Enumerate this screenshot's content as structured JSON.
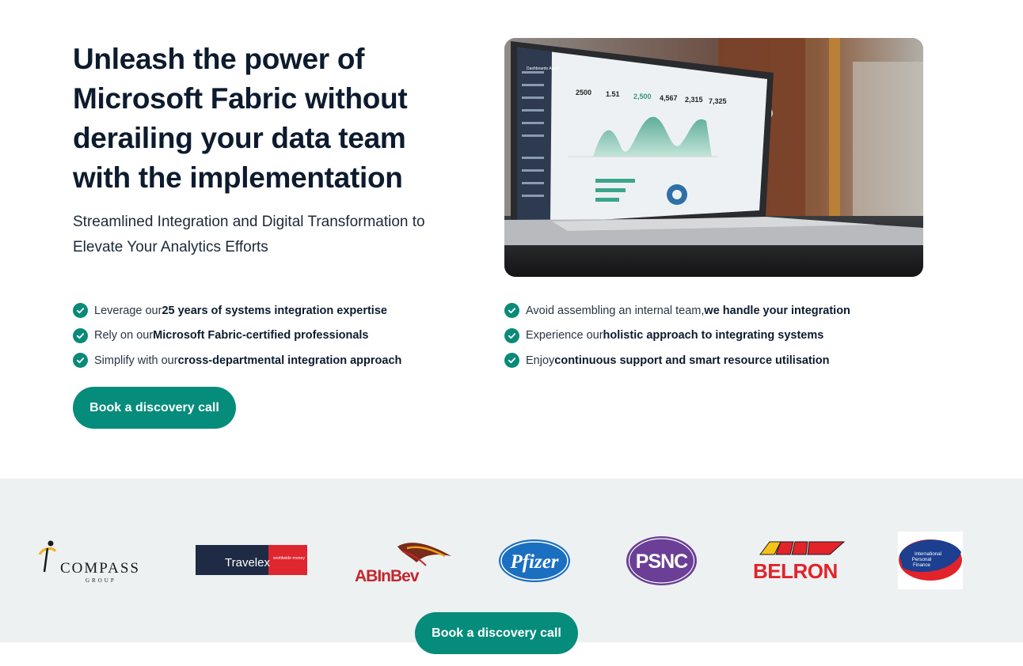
{
  "hero": {
    "headline": "Unleash the power of Microsoft Fabric without derailing your data team with the implementation",
    "subheadline": "Streamlined Integration and Digital Transformation to Elevate Your Analytics Efforts",
    "image_alt": "Laptop displaying an analytics dashboard",
    "dashboard": {
      "title": "Dashboardo Agent",
      "stats": [
        "2500",
        "1.51",
        "2,500",
        "4,567",
        "2,315",
        "7,325"
      ]
    }
  },
  "benefits_left": [
    {
      "pre": "Leverage our ",
      "bold": "25 years of systems integration expertise",
      "post": ""
    },
    {
      "pre": "Rely on our ",
      "bold": "Microsoft Fabric-certified professionals",
      "post": ""
    },
    {
      "pre": "Simplify with our ",
      "bold": "cross-departmental integration approach",
      "post": ""
    }
  ],
  "benefits_right": [
    {
      "pre": "Avoid assembling an internal team, ",
      "bold": "we handle your integration",
      "post": ""
    },
    {
      "pre": "Experience our ",
      "bold": "holistic approach to integrating systems",
      "post": ""
    },
    {
      "pre": "Enjoy ",
      "bold": "continuous support and smart resource utilisation",
      "post": ""
    }
  ],
  "cta": {
    "primary_label": "Book a discovery call",
    "secondary_label": "Book a discovery call"
  },
  "clients": {
    "compass": {
      "name": "COMPASS",
      "sub": "GROUP"
    },
    "travelex": {
      "name": "Travelex",
      "tag": "worldwide money"
    },
    "abinbev": {
      "name": "ABInBev"
    },
    "pfizer": {
      "name": "Pfizer"
    },
    "psnc": {
      "name": "PSNC"
    },
    "belron": {
      "name": "BELRON"
    },
    "ipf": {
      "name": "International Personal Finance"
    }
  },
  "colors": {
    "accent": "#068c7b",
    "heading": "#0d1b2e",
    "logos_band": "#eef1f2",
    "pfizer_blue": "#1b6fc1",
    "psnc_purple": "#6a3f95",
    "belron_red": "#e2232a",
    "travelex_navy": "#1f2a44"
  },
  "icons": {
    "check": "check-circle-icon"
  }
}
